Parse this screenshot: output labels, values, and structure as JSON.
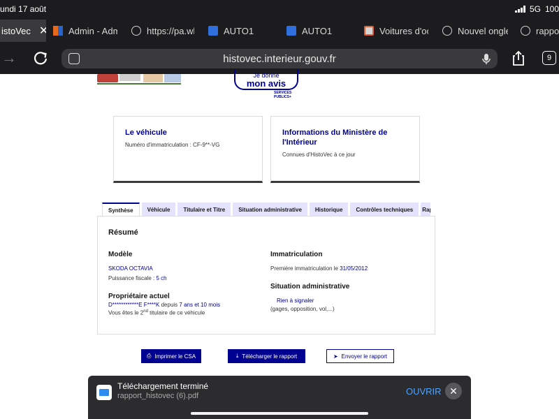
{
  "status": {
    "time": "undi 17 août",
    "network": "5G",
    "battery": "100"
  },
  "browser_tabs": [
    {
      "label": "istoVec",
      "icon": "close-icon"
    },
    {
      "label": "Admin - Adm",
      "icon": "admin-favicon"
    },
    {
      "label": "https://pa.wk",
      "icon": "globe-icon"
    },
    {
      "label": "AUTO1",
      "icon": "auto1-favicon"
    },
    {
      "label": "AUTO1",
      "icon": "auto1-favicon"
    },
    {
      "label": "Voitures d'oc",
      "icon": "image-favicon"
    },
    {
      "label": "Nouvel onglet",
      "icon": "globe-icon"
    },
    {
      "label": "rappor",
      "icon": "globe-icon"
    }
  ],
  "nav": {
    "url": "histovec.interieur.gouv.fr",
    "tab_count": "9"
  },
  "banner": {
    "avis_line1": "Je donne",
    "avis_line2": "mon avis",
    "services_publics": "SERVICES PUBLICS+"
  },
  "cards": {
    "vehicle_title": "Le véhicule",
    "vehicle_text": "Numéro d'immatriculation : CF-9**-VG",
    "ministry_title": "Informations du Ministère de l'Intérieur",
    "ministry_text": "Connues d'HistoVec à ce jour"
  },
  "page_tabs": [
    "Synthèse",
    "Véhicule",
    "Titulaire et Titre",
    "Situation administrative",
    "Historique",
    "Contrôles techniques",
    "Rap"
  ],
  "summary": {
    "title": "Résumé",
    "model_label": "Modèle",
    "model_value": "SKODA OCTAVIA",
    "fiscal_label": "Puissance fiscale : ",
    "fiscal_value": "5 ch",
    "owner_label": "Propriétaire actuel",
    "owner_name": "D************E F****K",
    "owner_since_prefix": " depuis ",
    "owner_since": "7 ans et 10 mois",
    "titulaire_prefix": "Vous êtes le 2",
    "titulaire_sup": "nd",
    "titulaire_suffix": " titulaire de ce véhicule",
    "immat_label": "Immatriculation",
    "first_immat_prefix": "Première immatriculation le ",
    "first_immat_date": "31/05/2012",
    "admin_label": "Situation administrative",
    "admin_value": "Rien à signaler",
    "admin_note": "(gages, opposition, vol,...)"
  },
  "actions": {
    "print": "Imprimer le CSA",
    "download": "Télécharger le rapport",
    "send": "Envoyer le rapport"
  },
  "download": {
    "title": "Téléchargement terminé",
    "filename": "rapport_histovec (6).pdf",
    "open": "OUVRIR"
  },
  "colors": {
    "brand_blue": "#000091",
    "tab_bg": "#e3e3fd",
    "ios_accent": "#4ea3ff"
  }
}
